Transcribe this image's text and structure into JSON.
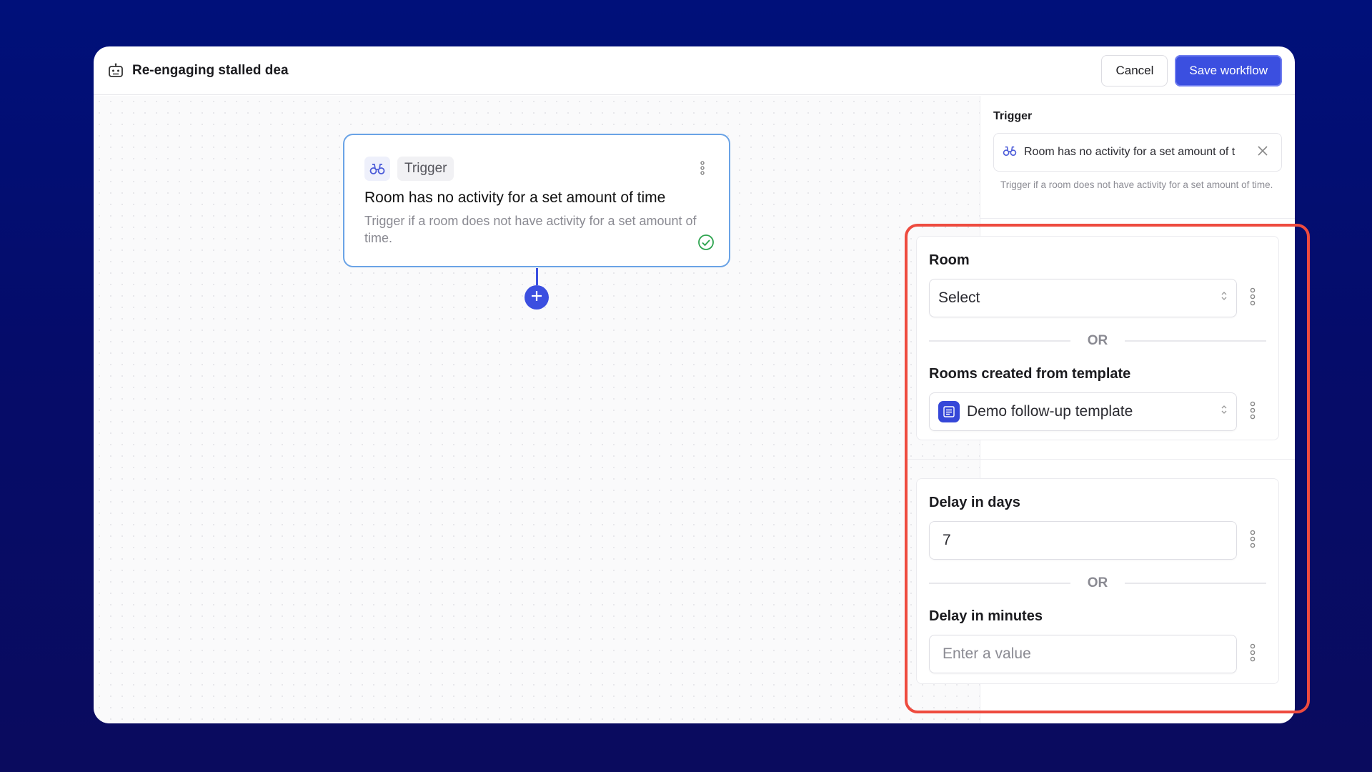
{
  "header": {
    "title": "Re-engaging stalled dea",
    "title_icon": "robot-icon",
    "cancel_label": "Cancel",
    "save_label": "Save workflow"
  },
  "node": {
    "badge": "Trigger",
    "icon": "binoculars-icon",
    "title": "Room has no activity for a set amount of time",
    "description": "Trigger if a room does not have activity for a set amount of time.",
    "status_icon": "check-circle-icon"
  },
  "panel": {
    "trigger_label": "Trigger",
    "trigger_value": "Room has no activity for a set amount of t",
    "trigger_help": "Trigger if a room does not have activity for a set amount of time.",
    "room": {
      "label": "Room",
      "value": "Select"
    },
    "or_label": "OR",
    "template": {
      "label": "Rooms created from template",
      "value": "Demo follow-up template"
    },
    "delay_days": {
      "label": "Delay in days",
      "value": "7"
    },
    "delay_minutes": {
      "label": "Delay in minutes",
      "placeholder": "Enter a value"
    }
  },
  "colors": {
    "accent": "#3b4fe0",
    "highlight": "#ee4b3f",
    "node_border": "#6aa3e6",
    "success": "#2ea44f"
  }
}
